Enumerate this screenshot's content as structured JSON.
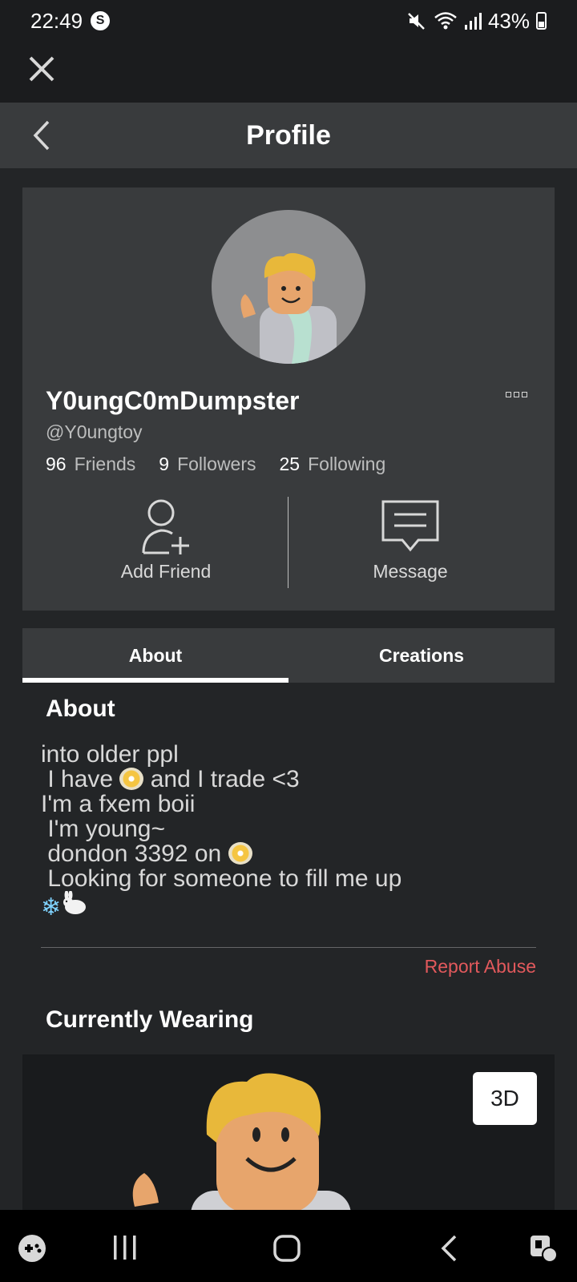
{
  "status_bar": {
    "time": "22:49",
    "app_icon": "S",
    "battery": "43%"
  },
  "header": {
    "title": "Profile"
  },
  "profile": {
    "display_name": "Y0ungC0mDumpster",
    "username": "@Y0ungtoy",
    "stats": [
      {
        "count": "96",
        "label": "Friends"
      },
      {
        "count": "9",
        "label": "Followers"
      },
      {
        "count": "25",
        "label": "Following"
      }
    ],
    "actions": {
      "add_friend": "Add Friend",
      "message": "Message"
    }
  },
  "tabs": [
    {
      "label": "About",
      "active": true
    },
    {
      "label": "Creations",
      "active": false
    }
  ],
  "about": {
    "title": "About",
    "lines": [
      "into older ppl",
      " I have ",
      " and I trade <3",
      "I'm a fxem boii",
      " I'm young~",
      " dondon 3392 on ",
      " Looking for someone to fill me up"
    ],
    "report": "Report Abuse"
  },
  "wearing": {
    "title": "Currently Wearing",
    "view_3d": "3D"
  },
  "colors": {
    "background": "#232527",
    "card": "#393b3d",
    "report": "#e2595c"
  }
}
